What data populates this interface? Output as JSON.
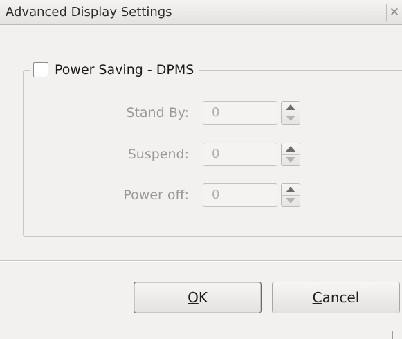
{
  "window": {
    "title": "Advanced Display Settings",
    "close_icon": "close-icon"
  },
  "dpms": {
    "checkbox_checked": false,
    "label": "Power Saving - DPMS",
    "fields": [
      {
        "label": "Stand By:",
        "value": "0"
      },
      {
        "label": "Suspend:",
        "value": "0"
      },
      {
        "label": "Power off:",
        "value": "0"
      }
    ]
  },
  "buttons": {
    "ok": {
      "mnemonic": "O",
      "rest": "K"
    },
    "cancel": {
      "mnemonic": "C",
      "rest": "ancel"
    }
  }
}
